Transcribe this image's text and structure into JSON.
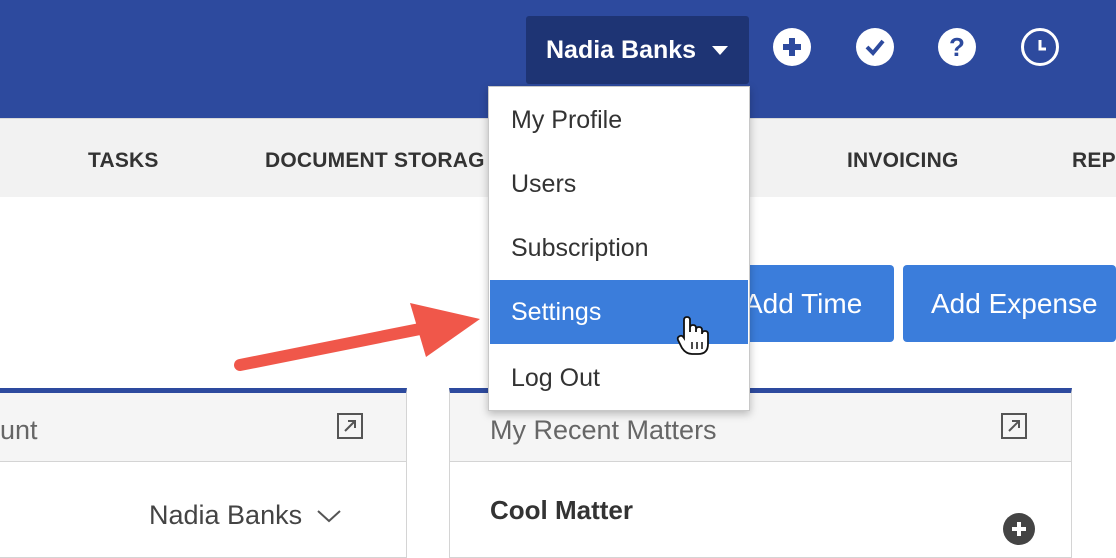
{
  "header": {
    "user_name": "Nadia Banks",
    "icons": [
      "plus-circle-icon",
      "check-circle-icon",
      "help-circle-icon",
      "clock-icon"
    ]
  },
  "nav": {
    "items": [
      "TASKS",
      "DOCUMENT STORAG",
      "INVOICING",
      "REP"
    ]
  },
  "actions": {
    "add_time": "Add Time",
    "add_expense": "Add Expense"
  },
  "left_panel": {
    "title": "unt",
    "user_select": "Nadia Banks"
  },
  "right_panel": {
    "title": "My Recent Matters",
    "matter_name": "Cool Matter"
  },
  "menu": {
    "items": [
      "My Profile",
      "Users",
      "Subscription",
      "Settings",
      "Log Out"
    ],
    "active": "Settings"
  },
  "colors": {
    "header_bg": "#2d4a9e",
    "user_button_bg": "#1e3474",
    "accent": "#3b7ddb",
    "annotation_arrow": "#f0574a"
  }
}
